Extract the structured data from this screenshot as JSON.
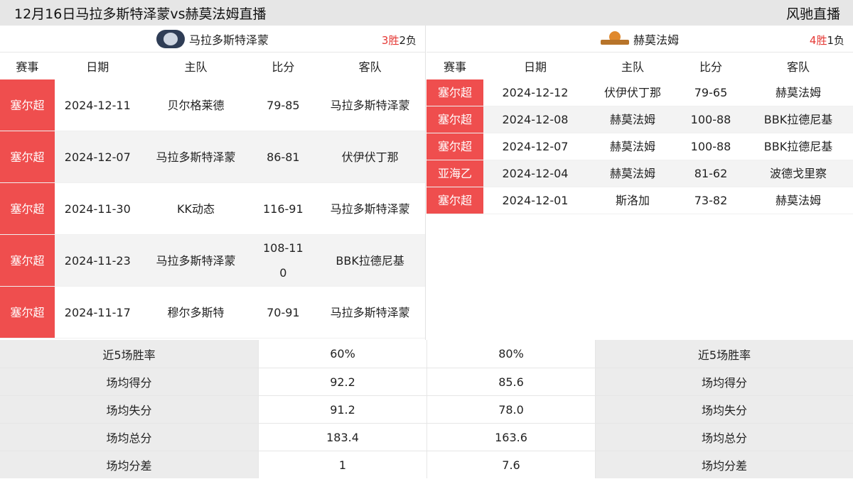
{
  "header": {
    "title": "12月16日马拉多斯特泽蒙vs赫莫法姆直播",
    "site": "风驰直播"
  },
  "left": {
    "team": "马拉多斯特泽蒙",
    "record_win": "3胜",
    "record_loss": "2负",
    "cols": [
      "赛事",
      "日期",
      "主队",
      "比分",
      "客队"
    ],
    "rows": [
      {
        "league": "塞尔超",
        "date": "2024-12-11",
        "home": "贝尔格莱德",
        "score": "79-85",
        "away": "马拉多斯特泽蒙"
      },
      {
        "league": "塞尔超",
        "date": "2024-12-07",
        "home": "马拉多斯特泽蒙",
        "score": "86-81",
        "away": "伏伊伏丁那"
      },
      {
        "league": "塞尔超",
        "date": "2024-11-30",
        "home": "KK动态",
        "score": "116-91",
        "away": "马拉多斯特泽蒙"
      },
      {
        "league": "塞尔超",
        "date": "2024-11-23",
        "home": "马拉多斯特泽蒙",
        "score": "108-110",
        "away": "BBK拉德尼基"
      },
      {
        "league": "塞尔超",
        "date": "2024-11-17",
        "home": "穆尔多斯特",
        "score": "70-91",
        "away": "马拉多斯特泽蒙"
      }
    ]
  },
  "right": {
    "team": "赫莫法姆",
    "record_win": "4胜",
    "record_loss": "1负",
    "cols": [
      "赛事",
      "日期",
      "主队",
      "比分",
      "客队"
    ],
    "rows": [
      {
        "league": "塞尔超",
        "date": "2024-12-12",
        "home": "伏伊伏丁那",
        "score": "79-65",
        "away": "赫莫法姆"
      },
      {
        "league": "塞尔超",
        "date": "2024-12-08",
        "home": "赫莫法姆",
        "score": "100-88",
        "away": "BBK拉德尼基"
      },
      {
        "league": "塞尔超",
        "date": "2024-12-07",
        "home": "赫莫法姆",
        "score": "100-88",
        "away": "BBK拉德尼基"
      },
      {
        "league": "亚海乙",
        "date": "2024-12-04",
        "home": "赫莫法姆",
        "score": "81-62",
        "away": "波德戈里察"
      },
      {
        "league": "塞尔超",
        "date": "2024-12-01",
        "home": "斯洛加",
        "score": "73-82",
        "away": "赫莫法姆"
      }
    ]
  },
  "stats": [
    {
      "label": "近5场胜率",
      "left": "60%",
      "right": "80%"
    },
    {
      "label": "场均得分",
      "left": "92.2",
      "right": "85.6"
    },
    {
      "label": "场均失分",
      "left": "91.2",
      "right": "78.0"
    },
    {
      "label": "场均总分",
      "left": "183.4",
      "right": "163.6"
    },
    {
      "label": "场均分差",
      "left": "1",
      "right": "7.6"
    }
  ],
  "colors": {
    "league_bg": "#ef4e4e",
    "win": "#e53935",
    "alt_row": "#f3f3f3"
  },
  "icons": {
    "left_logo": "team-crest-icon",
    "right_logo": "basketball-crest-icon"
  }
}
